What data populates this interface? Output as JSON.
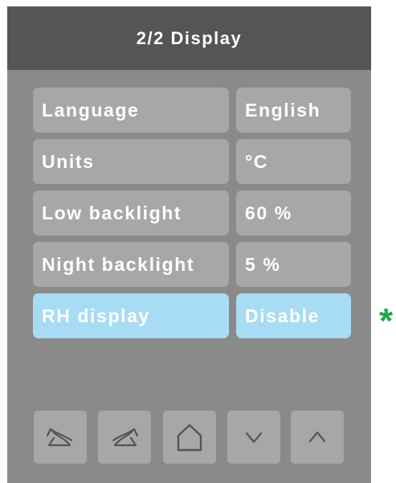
{
  "header": {
    "title": "2/2 Display"
  },
  "settings": [
    {
      "label": "Language",
      "value": "English"
    },
    {
      "label": "Units",
      "value": "°C"
    },
    {
      "label": "Low backlight",
      "value": "60 %"
    },
    {
      "label": "Night backlight",
      "value": "5 %"
    },
    {
      "label": "RH display",
      "value": "Disable",
      "selected": true
    }
  ],
  "marker": {
    "symbol": "*",
    "color": "#1faa4a"
  },
  "colors": {
    "panel": "#8a8a8a",
    "header": "#555555",
    "cell": "#a7a7a7",
    "selected_cell": "#a8dcf4",
    "icon_stroke": "#555555"
  },
  "nav": {
    "buttons": [
      "undo-icon",
      "redo-icon",
      "home-icon",
      "chevron-down-icon",
      "chevron-up-icon"
    ]
  }
}
